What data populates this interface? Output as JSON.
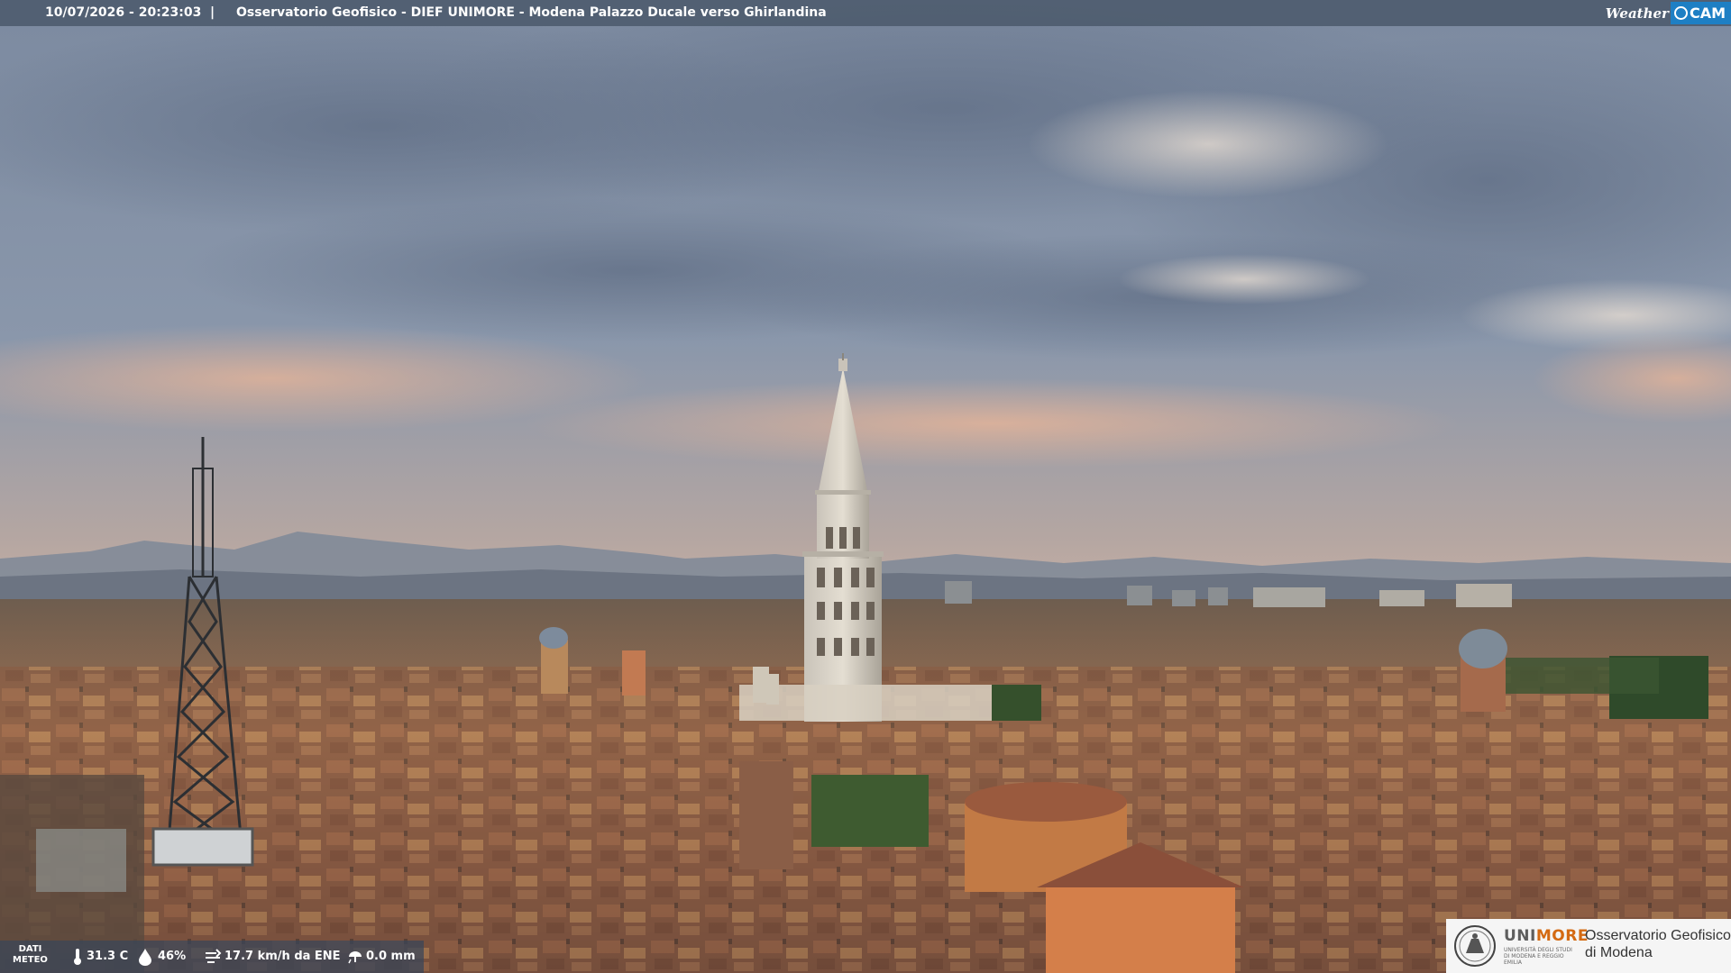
{
  "header": {
    "timestamp": "10/07/2026 - 20:23:03",
    "separator": "|",
    "title": "Osservatorio Geofisico - DIEF UNIMORE - Modena Palazzo Ducale verso Ghirlandina"
  },
  "brand": {
    "weather": "Weather",
    "cam": "CAM",
    "accent": "#1e7fc4"
  },
  "meteo": {
    "label_line1": "DATI",
    "label_line2": "METEO",
    "temperature": "31.3 C",
    "humidity": "46%",
    "wind": "17.7 km/h da ENE",
    "rain": "0.0 mm",
    "icons": [
      "thermometer-icon",
      "droplet-icon",
      "wind-icon",
      "rain-icon"
    ]
  },
  "logo": {
    "uni_prefix": "UNI",
    "uni_suffix": "MORE",
    "uni_subtitle": "UNIVERSITÀ DEGLI STUDI DI MODENA E REGGIO EMILIA",
    "observatory_line1": "Osservatorio Geofisico",
    "observatory_line2": "di Modena",
    "accent": "#d46a13"
  }
}
